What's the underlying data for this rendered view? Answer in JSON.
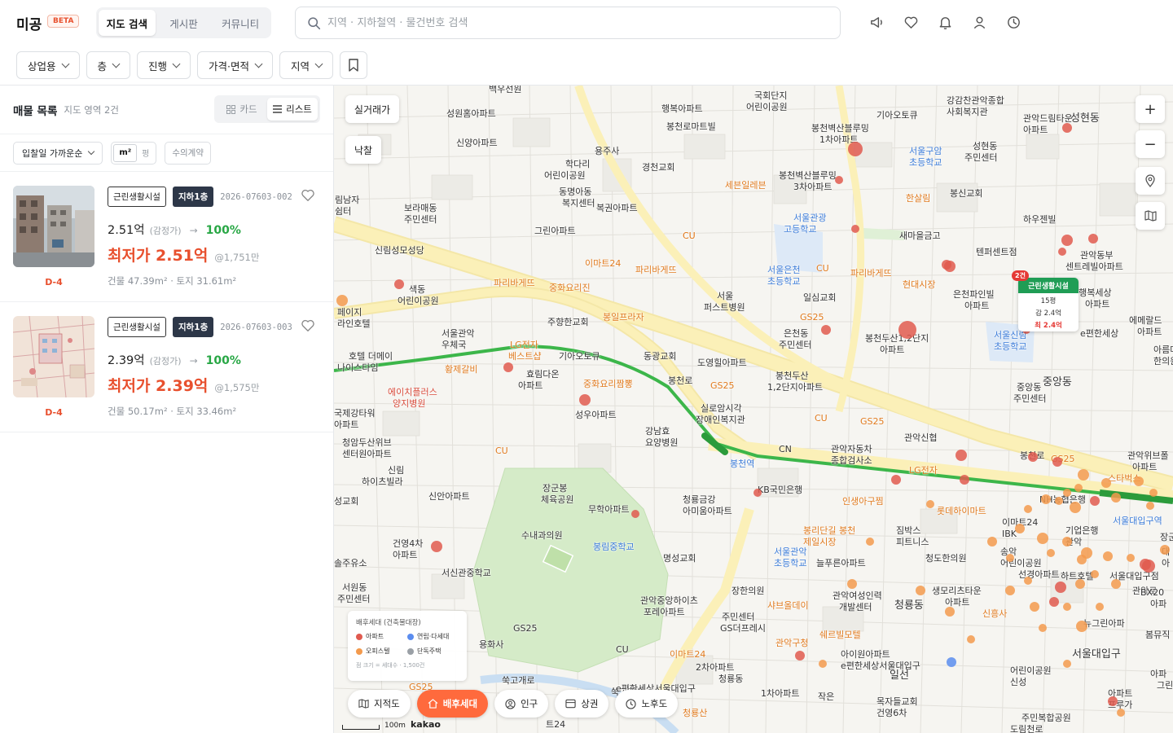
{
  "header": {
    "brand": "미공",
    "beta": "BETA",
    "tabs": [
      "지도 검색",
      "게시판",
      "커뮤니티"
    ],
    "search_placeholder": "지역 · 지하철역 · 물건번호 검색",
    "icons": [
      "megaphone-icon",
      "heart-icon",
      "bell-icon",
      "user-icon",
      "clock-icon"
    ]
  },
  "filters": [
    "상업용",
    "층",
    "진행",
    "가격·면적",
    "지역"
  ],
  "sidebar": {
    "title": "매물 목록",
    "subtitle": "지도 영역 2건",
    "view_card": "카드",
    "view_list": "리스트",
    "sort": "입찰일 가까운순",
    "unit_m2": "m²",
    "unit_py": "평",
    "contract": "수의계약",
    "listings": [
      {
        "category": "근린생활시설",
        "floor": "지하1층",
        "case_no": "2026-07603-002",
        "appraisal": "2.51억",
        "appraisal_note": "(감정가)",
        "arrow": "→",
        "rate": "100%",
        "min_price": "최저가 2.51억",
        "per_unit": "@1,751만",
        "areas": "건물 47.39m² · 토지 31.61m²",
        "dday": "D-4"
      },
      {
        "category": "근린생활시설",
        "floor": "지하1층",
        "case_no": "2026-07603-003",
        "appraisal": "2.39억",
        "appraisal_note": "(감정가)",
        "arrow": "→",
        "rate": "100%",
        "min_price": "최저가 2.39억",
        "per_unit": "@1,575만",
        "areas": "건물 50.17m² · 토지 33.46m²",
        "dday": "D-4"
      }
    ]
  },
  "map": {
    "btn_real": "실거래가",
    "btn_auction": "낙찰",
    "zoom_in": "+",
    "zoom_out": "−",
    "popup": {
      "count": "2건",
      "category": "근린생활시설",
      "size": "15평",
      "appraisal": "감 2.4억",
      "min": "최 2.4억"
    },
    "legend": {
      "title": "배후세대 (건축물대장)",
      "items": [
        {
          "label": "아파트",
          "color": "#e05a4f"
        },
        {
          "label": "연립·다세대",
          "color": "#5b8def"
        },
        {
          "label": "오피스텔",
          "color": "#f39a4d"
        },
        {
          "label": "단독주택",
          "color": "#9aa0a6"
        }
      ],
      "note": "점 크기 = 세대수 · 1,500건"
    },
    "layers": [
      "지적도",
      "배후세대",
      "인구",
      "상권",
      "노후도"
    ],
    "scale": "100m",
    "attribution": "kakao",
    "labels": [
      {
        "t": "백우선원"
      },
      {
        "t": "국회단지"
      },
      {
        "t": "어린이공원"
      },
      {
        "t": "강감찬관악종합"
      },
      {
        "t": "사회복지관"
      },
      {
        "t": "성원홈아파트"
      },
      {
        "t": "행복아파트"
      },
      {
        "t": "기아오토큐"
      },
      {
        "t": "관악드림타운"
      },
      {
        "t": "아파트"
      },
      {
        "t": "성현동"
      },
      {
        "t": "봉천로마트빌"
      },
      {
        "t": "봉천벽산블루밍"
      },
      {
        "t": "1차아파트"
      },
      {
        "t": "신양아파트"
      },
      {
        "t": "용주사"
      },
      {
        "t": "서울구암"
      },
      {
        "t": "초등학교"
      },
      {
        "t": "성현동"
      },
      {
        "t": "주민센터"
      },
      {
        "t": "학다리"
      },
      {
        "t": "어린이공원"
      },
      {
        "t": "경천교회"
      },
      {
        "t": "봉천벽산블루밍"
      },
      {
        "t": "3차아파트"
      },
      {
        "t": "세븐일레븐"
      },
      {
        "t": "CU"
      },
      {
        "t": "동명아동"
      },
      {
        "t": "복지센터"
      },
      {
        "t": "복권아파트"
      },
      {
        "t": "한살림"
      },
      {
        "t": "봉신교회"
      },
      {
        "t": "림남자"
      },
      {
        "t": "쉼터"
      },
      {
        "t": "보라매동"
      },
      {
        "t": "주민센터"
      },
      {
        "t": "서울관광"
      },
      {
        "t": "고등학교"
      },
      {
        "t": "하우젠빌"
      },
      {
        "t": "그린아파트"
      },
      {
        "t": "CU"
      },
      {
        "t": "새마을금고"
      },
      {
        "t": "신림성모성당"
      },
      {
        "t": "텐퍼센트점"
      },
      {
        "t": "관악동부"
      },
      {
        "t": "센트레빌아파트"
      },
      {
        "t": "이마트24"
      },
      {
        "t": "파리바게뜨"
      },
      {
        "t": "서울은천"
      },
      {
        "t": "초등학교"
      },
      {
        "t": "CU"
      },
      {
        "t": "파리바게뜨"
      },
      {
        "t": "파리바게뜨"
      },
      {
        "t": "중화요리진"
      },
      {
        "t": "서울"
      },
      {
        "t": "퍼스트병원"
      },
      {
        "t": "일심교회"
      },
      {
        "t": "현대시장"
      },
      {
        "t": "은천파인빌"
      },
      {
        "t": "아파트"
      },
      {
        "t": "동행복세상"
      },
      {
        "t": "아파트"
      },
      {
        "t": "색동"
      },
      {
        "t": "어린이공원"
      },
      {
        "t": "봉일프라자"
      },
      {
        "t": "GS25"
      },
      {
        "t": "페이지"
      },
      {
        "t": "라인호텔"
      },
      {
        "t": "주향한교회"
      },
      {
        "t": "서울관악"
      },
      {
        "t": "우체국"
      },
      {
        "t": "LG전자"
      },
      {
        "t": "베스트샵"
      },
      {
        "t": "은천동"
      },
      {
        "t": "주민센터"
      },
      {
        "t": "봉천두산1,2단지"
      },
      {
        "t": "아파트"
      },
      {
        "t": "서울신림"
      },
      {
        "t": "초등학교"
      },
      {
        "t": "e편한세상"
      },
      {
        "t": "에메랄드"
      },
      {
        "t": "아파트"
      },
      {
        "t": "기아오토큐"
      },
      {
        "t": "동광교회"
      },
      {
        "t": "호텔 더메이"
      },
      {
        "t": "나이스타임"
      },
      {
        "t": "도영힐아파트"
      },
      {
        "t": "아름다운"
      },
      {
        "t": "한의원"
      },
      {
        "t": "효림다온"
      },
      {
        "t": "아파트"
      },
      {
        "t": "황제갈비"
      },
      {
        "t": "봉천두산"
      },
      {
        "t": "1,2단지아파트"
      },
      {
        "t": "중앙동"
      },
      {
        "t": "중앙동"
      },
      {
        "t": "주민센터"
      },
      {
        "t": "중화요리짬뽕"
      },
      {
        "t": "에이치플러스"
      },
      {
        "t": "양지병원"
      },
      {
        "t": "GS25"
      },
      {
        "t": "봉천로"
      },
      {
        "t": "실로암시각"
      },
      {
        "t": "장애인복지관"
      },
      {
        "t": "성우아파트"
      },
      {
        "t": "CU"
      },
      {
        "t": "GS25"
      },
      {
        "t": "국제강타워"
      },
      {
        "t": "아파트"
      },
      {
        "t": "강남효"
      },
      {
        "t": "요양병원"
      },
      {
        "t": "관악신협"
      },
      {
        "t": "청암두산위브"
      },
      {
        "t": "센터원아파트"
      },
      {
        "t": "CU"
      },
      {
        "t": "CN"
      },
      {
        "t": "봉천역"
      },
      {
        "t": "관악자동차"
      },
      {
        "t": "종합검사소"
      },
      {
        "t": "봉천로"
      },
      {
        "t": "관악위브폴"
      },
      {
        "t": "아파트"
      },
      {
        "t": "GS25"
      },
      {
        "t": "LG전자"
      },
      {
        "t": "신림"
      },
      {
        "t": "하이츠빌라"
      },
      {
        "t": "KB국민은행"
      },
      {
        "t": "스타벅스"
      },
      {
        "t": "신안아파트"
      },
      {
        "t": "장군봉"
      },
      {
        "t": "체육공원"
      },
      {
        "t": "청룡금강"
      },
      {
        "t": "아미움아파트"
      },
      {
        "t": "인생아구찜"
      },
      {
        "t": "롯데하이마트"
      },
      {
        "t": "NH농협은행"
      },
      {
        "t": "서울대입구역"
      },
      {
        "t": "성교회"
      },
      {
        "t": "무학아파트"
      },
      {
        "t": "이마트24"
      },
      {
        "t": "IBK"
      },
      {
        "t": "기업은행"
      },
      {
        "t": "관악"
      },
      {
        "t": "수내과의원"
      },
      {
        "t": "장군봉"
      },
      {
        "t": "봉리단길 봉천"
      },
      {
        "t": "제일시장"
      },
      {
        "t": "짐박스"
      },
      {
        "t": "피트니스"
      },
      {
        "t": "건영4차"
      },
      {
        "t": "아파트"
      },
      {
        "t": "봉림중학교"
      },
      {
        "t": "명성교회"
      },
      {
        "t": "서울관악"
      },
      {
        "t": "초등학교"
      },
      {
        "t": "늘푸른아파트"
      },
      {
        "t": "청도한의원"
      },
      {
        "t": "송악"
      },
      {
        "t": "어린이공원"
      },
      {
        "t": "대"
      },
      {
        "t": "아"
      },
      {
        "t": "솔주유소"
      },
      {
        "t": "서신관중학교"
      },
      {
        "t": "선경아파트"
      },
      {
        "t": "하트호텔"
      },
      {
        "t": "서울대입구점"
      },
      {
        "t": "관악로"
      },
      {
        "t": "서원동"
      },
      {
        "t": "주민센터"
      },
      {
        "t": "장한의원"
      },
      {
        "t": "관악중앙하이츠"
      },
      {
        "t": "포레아파트"
      },
      {
        "t": "관악여성인력"
      },
      {
        "t": "개발센터"
      },
      {
        "t": "생모리츠타운"
      },
      {
        "t": "아파트"
      },
      {
        "t": "BX20"
      },
      {
        "t": "아파"
      },
      {
        "t": "샤브올데이"
      },
      {
        "t": "청룡동"
      },
      {
        "t": "주민센터"
      },
      {
        "t": "GS더프레시"
      },
      {
        "t": "신흥사"
      },
      {
        "t": "GS25"
      },
      {
        "t": "쉐르빌모텔"
      },
      {
        "t": "뉴그린아파"
      },
      {
        "t": "봄뮤직"
      },
      {
        "t": "용화사"
      },
      {
        "t": "CU"
      },
      {
        "t": "이마트24"
      },
      {
        "t": "관악구청"
      },
      {
        "t": "서울대입구"
      },
      {
        "t": "아이원아파트"
      },
      {
        "t": "e편한세상서울대입구"
      },
      {
        "t": "2차아파트"
      },
      {
        "t": "청룡동"
      },
      {
        "t": "일선"
      },
      {
        "t": "어린이공원"
      },
      {
        "t": "신성"
      },
      {
        "t": "아파"
      },
      {
        "t": "그린피쉬"
      },
      {
        "t": "쑥고개로"
      },
      {
        "t": "쑥고개사"
      },
      {
        "t": "e편한세상서울대입구"
      },
      {
        "t": "1차아파트"
      },
      {
        "t": "작은"
      },
      {
        "t": "목자들교회"
      },
      {
        "t": "건영6차"
      },
      {
        "t": "아파트"
      },
      {
        "t": "프루가"
      },
      {
        "t": "GS25"
      },
      {
        "t": "청룡산"
      },
      {
        "t": "주민복합공원"
      },
      {
        "t": "도림천로"
      },
      {
        "t": "트24"
      }
    ]
  }
}
